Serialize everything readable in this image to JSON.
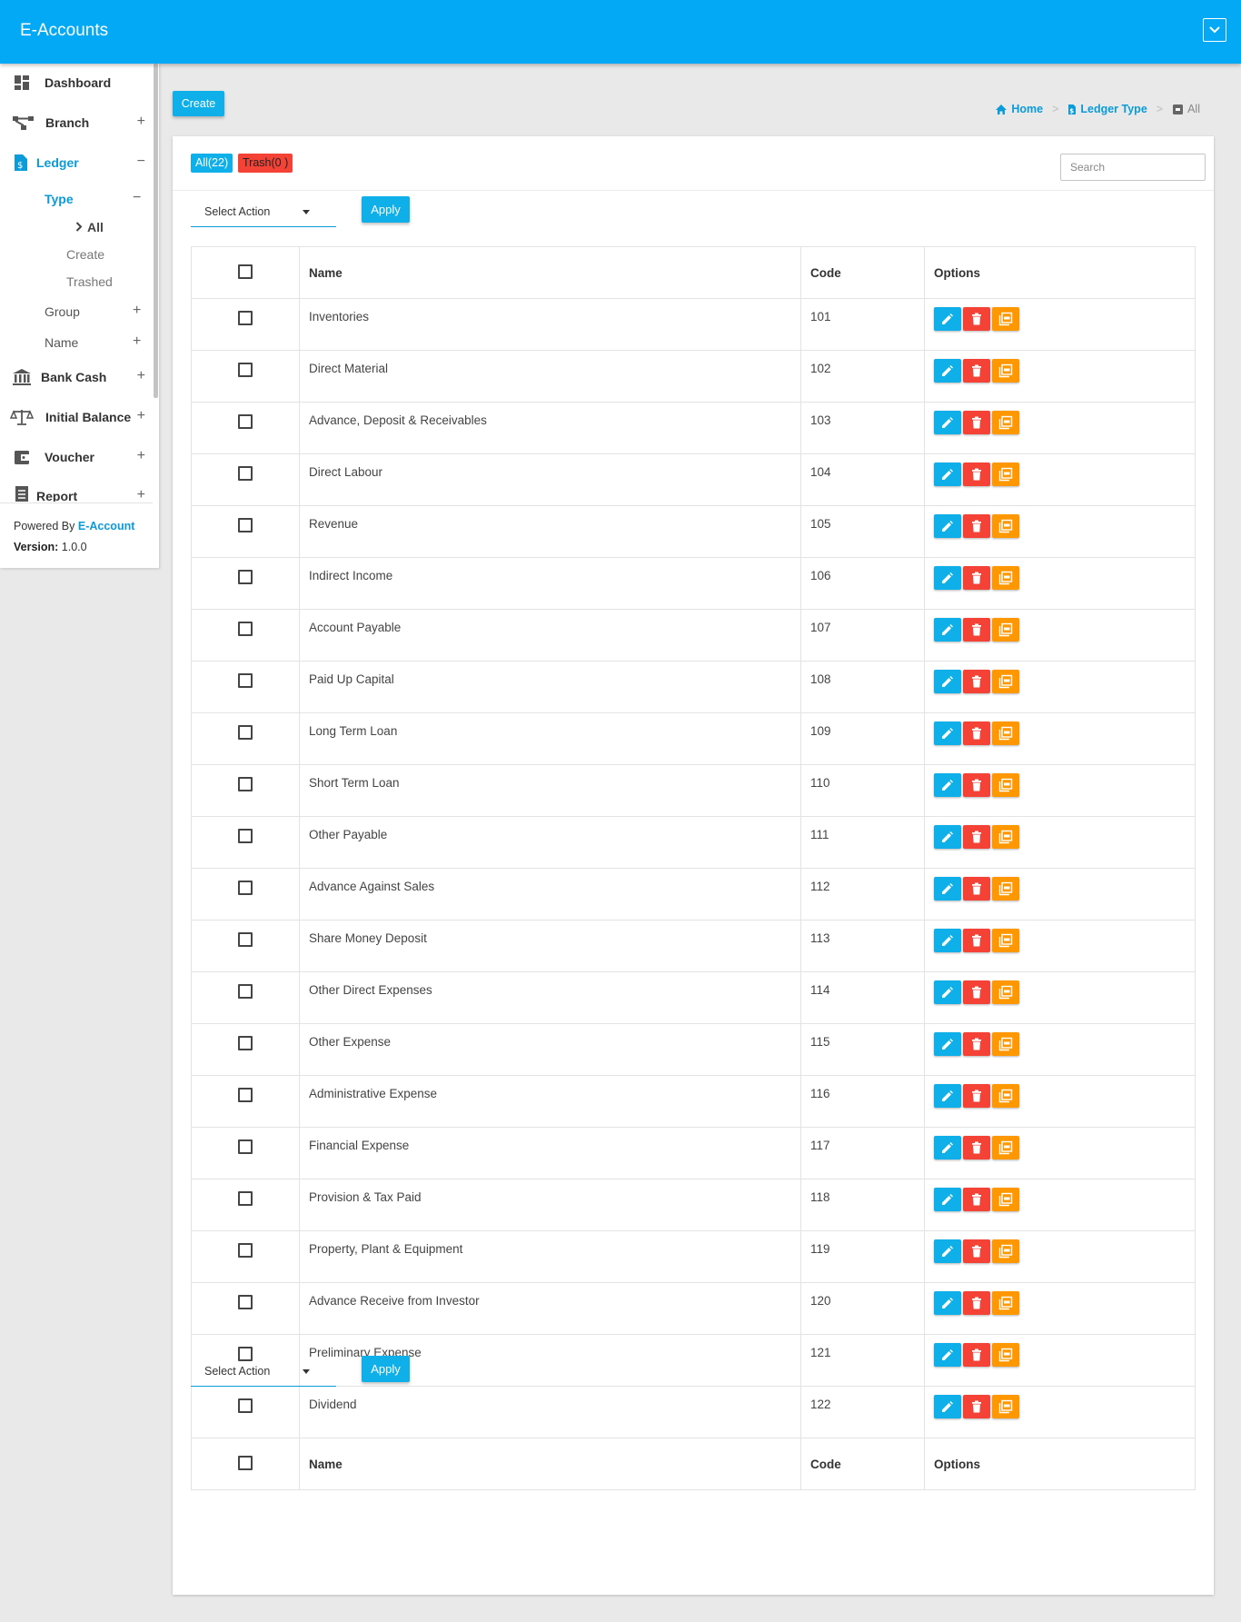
{
  "app": {
    "title": "E-Accounts"
  },
  "colors": {
    "primary": "#03a9f4",
    "button": "#0fb0ea",
    "danger": "#f44336",
    "warning": "#ff9800"
  },
  "sidebar": {
    "items": [
      {
        "label": "Dashboard",
        "icon": "dashboard-icon"
      },
      {
        "label": "Branch",
        "icon": "branch-icon",
        "toggle": "+"
      },
      {
        "label": "Ledger",
        "icon": "ledger-icon",
        "toggle": "−"
      },
      {
        "label": "Bank Cash",
        "icon": "bank-icon",
        "toggle": "+"
      },
      {
        "label": "Initial Balance",
        "icon": "balance-scale-icon",
        "toggle": "+"
      },
      {
        "label": "Voucher",
        "icon": "wallet-icon",
        "toggle": "+"
      },
      {
        "label": "Report",
        "icon": "report-icon",
        "toggle": "+"
      }
    ],
    "ledger_sub": {
      "type": {
        "label": "Type",
        "toggle": "−"
      },
      "type_children": [
        "All",
        "Create",
        "Trashed"
      ],
      "group": {
        "label": "Group",
        "toggle": "+"
      },
      "name": {
        "label": "Name",
        "toggle": "+"
      }
    },
    "footer": {
      "powered_by": "Powered By ",
      "powered_link": "E-Account",
      "version_label": "Version:",
      "version": " 1.0.0"
    }
  },
  "toolbar": {
    "create_label": "Create"
  },
  "breadcrumb": {
    "home": "Home",
    "ledger_type": "Ledger Type",
    "current": "All"
  },
  "filters": {
    "all_label": "All(22)",
    "trash_label": "Trash(0 )",
    "search_placeholder": "Search"
  },
  "bulk": {
    "select_label": "Select Action",
    "apply_label": "Apply"
  },
  "table": {
    "headers": {
      "name": "Name",
      "code": "Code",
      "options": "Options"
    },
    "rows": [
      {
        "name": "Inventories",
        "code": "101"
      },
      {
        "name": "Direct Material",
        "code": "102"
      },
      {
        "name": "Advance, Deposit & Receivables",
        "code": "103"
      },
      {
        "name": "Direct Labour",
        "code": "104"
      },
      {
        "name": "Revenue",
        "code": "105"
      },
      {
        "name": "Indirect Income",
        "code": "106"
      },
      {
        "name": "Account Payable",
        "code": "107"
      },
      {
        "name": "Paid Up Capital",
        "code": "108"
      },
      {
        "name": "Long Term Loan",
        "code": "109"
      },
      {
        "name": "Short Term Loan",
        "code": "110"
      },
      {
        "name": "Other Payable",
        "code": "111"
      },
      {
        "name": "Advance Against Sales",
        "code": "112"
      },
      {
        "name": "Share Money Deposit",
        "code": "113"
      },
      {
        "name": "Other Direct Expenses",
        "code": "114"
      },
      {
        "name": "Other Expense",
        "code": "115"
      },
      {
        "name": "Administrative Expense",
        "code": "116"
      },
      {
        "name": "Financial Expense",
        "code": "117"
      },
      {
        "name": "Provision & Tax Paid",
        "code": "118"
      },
      {
        "name": "Property, Plant & Equipment",
        "code": "119"
      },
      {
        "name": "Advance Receive from Investor",
        "code": "120"
      },
      {
        "name": "Preliminary Expense",
        "code": "121"
      },
      {
        "name": "Dividend",
        "code": "122"
      }
    ]
  }
}
